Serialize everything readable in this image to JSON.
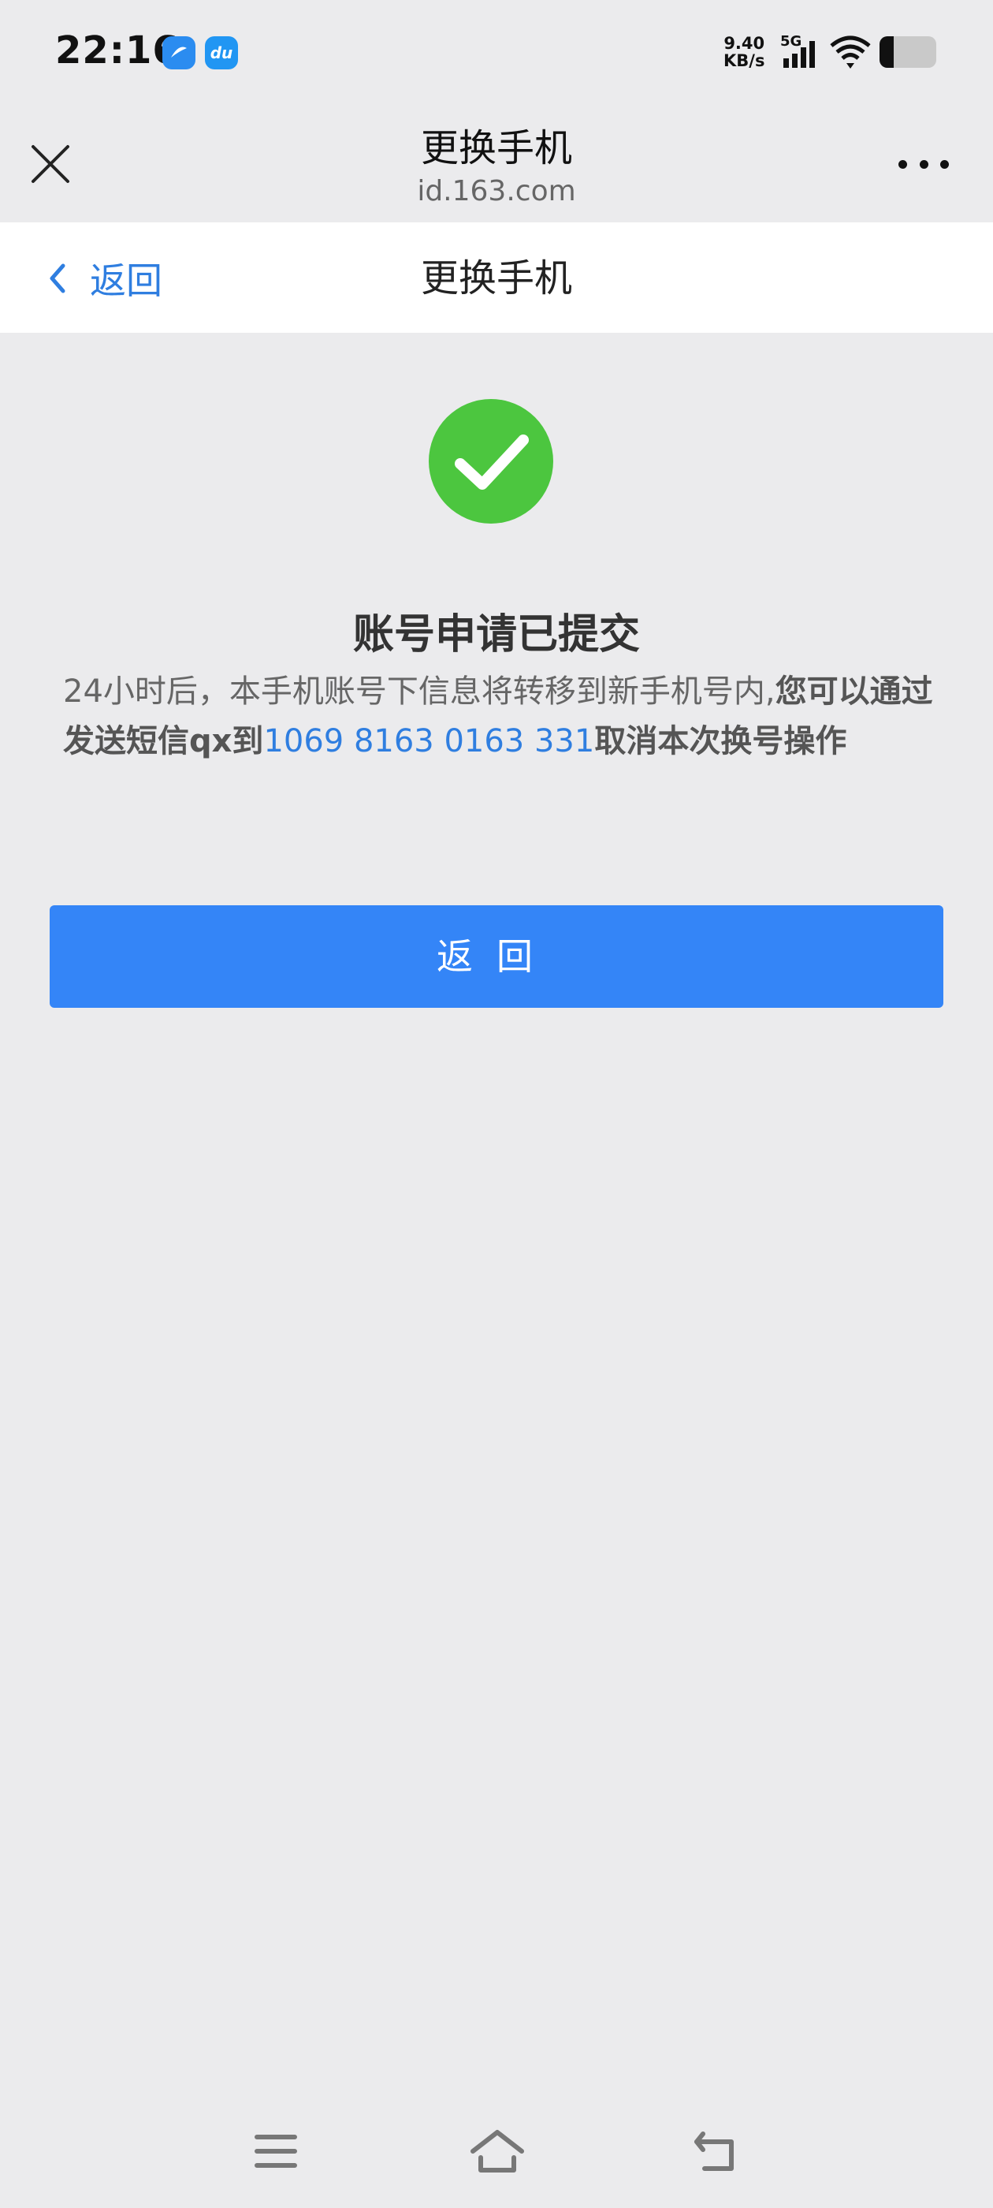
{
  "status": {
    "time": "22:16",
    "speed_value": "9.40",
    "speed_unit": "KB/s",
    "network": "5G",
    "battery_level": 0.25
  },
  "browser": {
    "title": "更换手机",
    "domain": "id.163.com"
  },
  "nav": {
    "back_label": "返回",
    "title": "更换手机"
  },
  "result": {
    "title": "账号申请已提交",
    "desc_part1": "24小时后，本手机账号下信息将转移到新手机号内,",
    "desc_part2_bold": "您可以通过发送短信qx到",
    "desc_number": "1069 8163 0163 331",
    "desc_part3_bold": "取消本次换号操作"
  },
  "button": {
    "back_label": "返回"
  },
  "colors": {
    "accent": "#3485f7",
    "success": "#4cc63f",
    "link": "#2f7ee0",
    "background": "#ebebed"
  },
  "icons": [
    "close-icon",
    "more-icon",
    "chevron-left-icon",
    "check-circle-icon",
    "menu-icon",
    "home-icon",
    "back-arrow-icon"
  ]
}
